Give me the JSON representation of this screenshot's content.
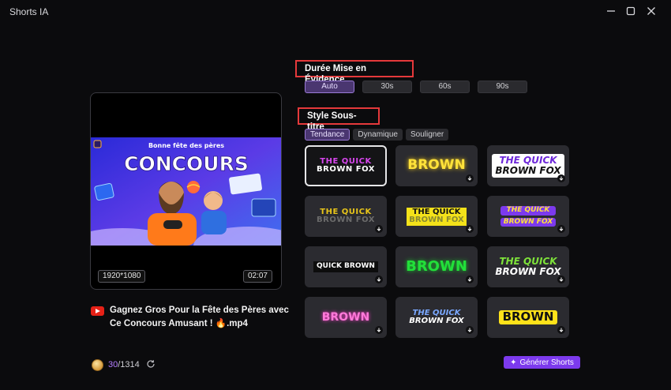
{
  "window": {
    "title": "Shorts IA"
  },
  "video": {
    "thumbnail_title": "Bonne fête des pères",
    "thumbnail_headline": "CONCOURS",
    "resolution": "1920*1080",
    "duration": "02:07",
    "file_name": "Gagnez Gros Pour la Fête des Pères avec Ce Concours Amusant ! 🔥.mp4"
  },
  "credits": {
    "used": "30",
    "total": "/1314"
  },
  "highlight_duration": {
    "label": "Durée Mise en Évidence",
    "options": [
      "Auto",
      "30s",
      "60s",
      "90s"
    ],
    "selected": "Auto"
  },
  "subtitle_style": {
    "label": "Style Sous-titre",
    "tabs": [
      "Tendance",
      "Dynamique",
      "Souligner"
    ],
    "active_tab": "Tendance",
    "presets": [
      {
        "line1": "THE QUICK",
        "line2": "BROWN FOX"
      },
      {
        "line1": "BROWN",
        "line2": ""
      },
      {
        "line1": "THE QUICK",
        "line2": "BROWN FOX"
      },
      {
        "line1": "THE QUICK",
        "line2": "BROWN FOX"
      },
      {
        "line1": "THE QUICK",
        "line2": "BROWN FOX"
      },
      {
        "line1": "THE QUICK",
        "line2": "BROWN FOX"
      },
      {
        "line1": "QUICK BROWN",
        "line2": ""
      },
      {
        "line1": "BROWN",
        "line2": ""
      },
      {
        "line1": "THE QUICK",
        "line2": "BROWN FOX"
      },
      {
        "line1": "BROWN",
        "line2": ""
      },
      {
        "line1": "THE QUICK",
        "line2": "BROWN FOX"
      },
      {
        "line1": "BROWN",
        "line2": ""
      }
    ]
  },
  "actions": {
    "generate": "Générer Shorts"
  },
  "colors": {
    "accent": "#7c3aed",
    "highlight_border": "#e5393b",
    "background": "#0b0b0d"
  }
}
